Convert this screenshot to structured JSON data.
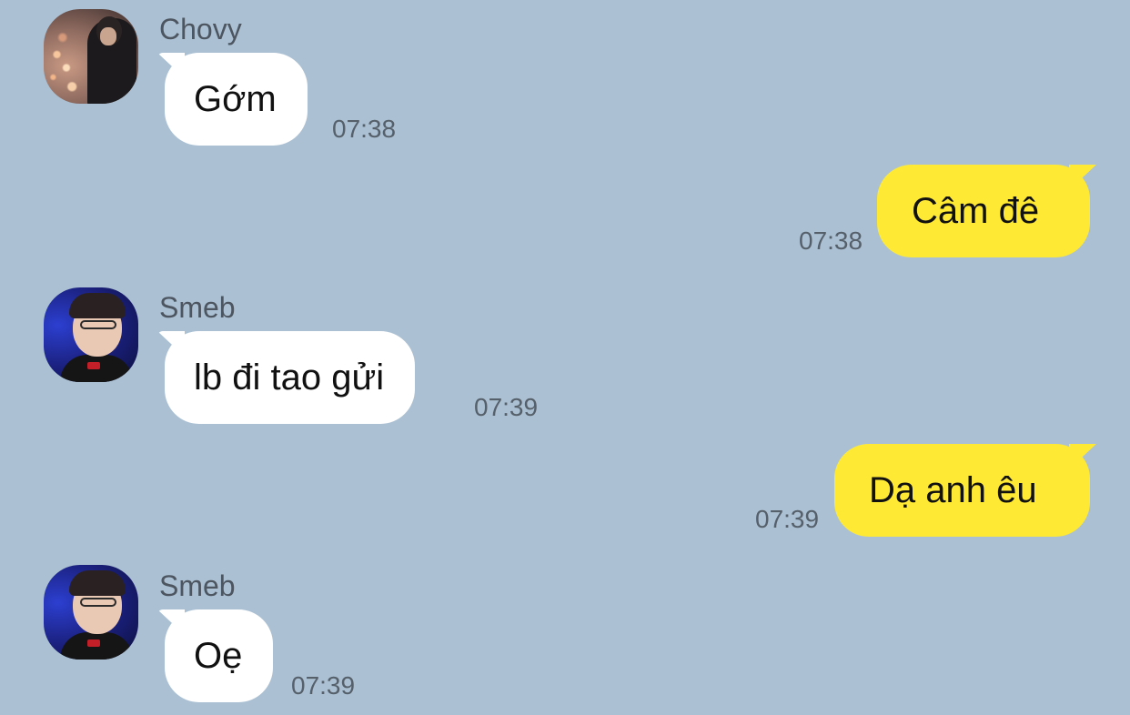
{
  "messages": [
    {
      "sender": "Chovy",
      "text": "Gớm",
      "time": "07:38",
      "direction": "incoming",
      "avatar": "chovy-avatar"
    },
    {
      "sender": "",
      "text": "Câm đê",
      "time": "07:38",
      "direction": "outgoing"
    },
    {
      "sender": "Smeb",
      "text": "lb đi tao gửi",
      "time": "07:39",
      "direction": "incoming",
      "avatar": "smeb-avatar"
    },
    {
      "sender": "",
      "text": "Dạ anh êu",
      "time": "07:39",
      "direction": "outgoing"
    },
    {
      "sender": "Smeb",
      "text": "Oẹ",
      "time": "07:39",
      "direction": "incoming",
      "avatar": "smeb-avatar"
    }
  ],
  "colors": {
    "background": "#abc1d3",
    "incoming_bubble": "#ffffff",
    "outgoing_bubble": "#fee934",
    "sender_text": "#4c5560",
    "timestamp_text": "#56606b"
  }
}
